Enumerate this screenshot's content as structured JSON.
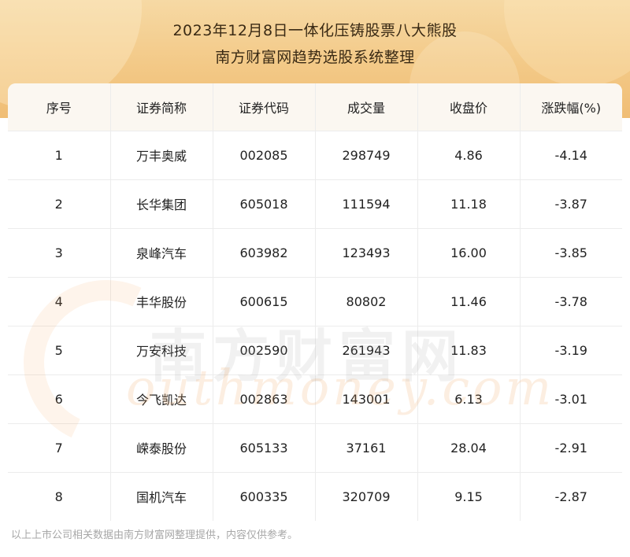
{
  "header": {
    "title_line1": "2023年12月8日一体化压铸股票八大熊股",
    "title_line2": "南方财富网趋势选股系统整理"
  },
  "table": {
    "columns": [
      "序号",
      "证券简称",
      "证券代码",
      "成交量",
      "收盘价",
      "涨跌幅(%)"
    ],
    "rows": [
      [
        "1",
        "万丰奥威",
        "002085",
        "298749",
        "4.86",
        "-4.14"
      ],
      [
        "2",
        "长华集团",
        "605018",
        "111594",
        "11.18",
        "-3.87"
      ],
      [
        "3",
        "泉峰汽车",
        "603982",
        "123493",
        "16.00",
        "-3.85"
      ],
      [
        "4",
        "丰华股份",
        "600615",
        "80802",
        "11.46",
        "-3.78"
      ],
      [
        "5",
        "万安科技",
        "002590",
        "261943",
        "11.83",
        "-3.19"
      ],
      [
        "6",
        "今飞凯达",
        "002863",
        "143001",
        "6.13",
        "-3.01"
      ],
      [
        "7",
        "嵘泰股份",
        "605133",
        "37161",
        "28.04",
        "-2.91"
      ],
      [
        "8",
        "国机汽车",
        "600335",
        "320709",
        "9.15",
        "-2.87"
      ]
    ]
  },
  "watermark": {
    "cn": "南方财富网",
    "en": "outhmoney.com"
  },
  "footer": {
    "note": "以上上市公司相关数据由南方财富网整理提供，内容仅供参考。"
  }
}
